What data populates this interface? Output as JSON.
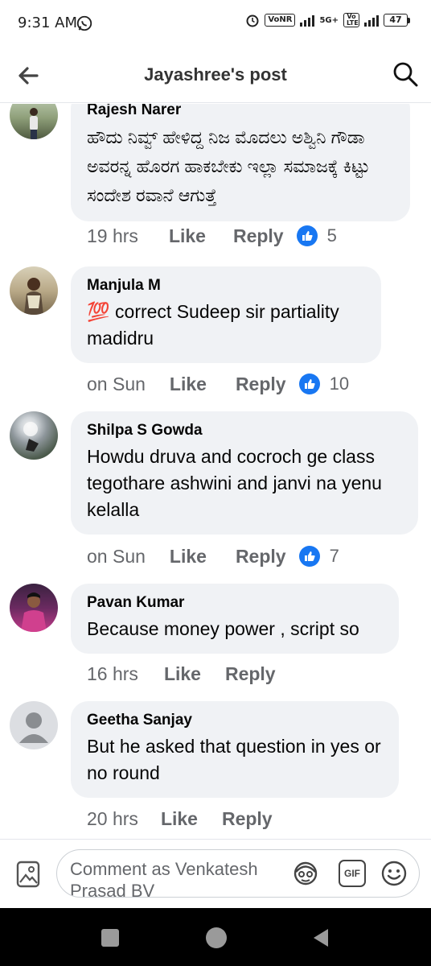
{
  "status": {
    "time": "9:31 AM",
    "volte_badge": "VoNR",
    "network_label": "5G+",
    "lte_badge": "Vo LTE",
    "battery": "47"
  },
  "header": {
    "title": "Jayashree's post",
    "back_icon": "arrow-left-icon",
    "search_icon": "search-icon"
  },
  "comments": [
    {
      "author": "Rajesh Narer",
      "text": "ಹೌದು ನಿವ್ವ್ ಹೇಳಿದ್ದ ನಿಜ ಮೊದಲು ಅಶ್ವಿನಿ ಗೌಡಾ ಅವರನ್ನ ಹೊರಗ ಹಾಕಬೇಕು ಇಲ್ಲಾ ಸಮಾಜಕ್ಕೆ ಕಿಟ್ಟು ಸಂದೇಶ ರವಾನೆ ಆಗುತ್ತೆ",
      "time": "19 hrs",
      "like": "Like",
      "reply": "Reply",
      "reactions": "5"
    },
    {
      "author": "Manjula M",
      "emoji": "💯",
      "text": "correct Sudeep sir partiality madidru",
      "time": "on Sun",
      "like": "Like",
      "reply": "Reply",
      "reactions": "10"
    },
    {
      "author": "Shilpa S Gowda",
      "text": "Howdu druva and cocroch ge class tegothare ashwini and janvi na yenu kelalla",
      "time": "on Sun",
      "like": "Like",
      "reply": "Reply",
      "reactions": "7"
    },
    {
      "author": "Pavan Kumar",
      "text": "Because money power , script so",
      "time": "16 hrs",
      "like": "Like",
      "reply": "Reply"
    },
    {
      "author": "Geetha Sanjay",
      "text": "But he asked that question in yes or no round",
      "time": "20 hrs",
      "like": "Like",
      "reply": "Reply"
    }
  ],
  "composer": {
    "placeholder": "Comment as Venkatesh Prasad BV",
    "photo_icon": "photo-icon",
    "avatar_icon": "avatar-sticker-icon",
    "gif_label": "GIF",
    "emoji_icon": "emoji-icon"
  },
  "colors": {
    "accent": "#1877f2",
    "bubble": "#f0f2f5",
    "meta_text": "#65676b"
  }
}
